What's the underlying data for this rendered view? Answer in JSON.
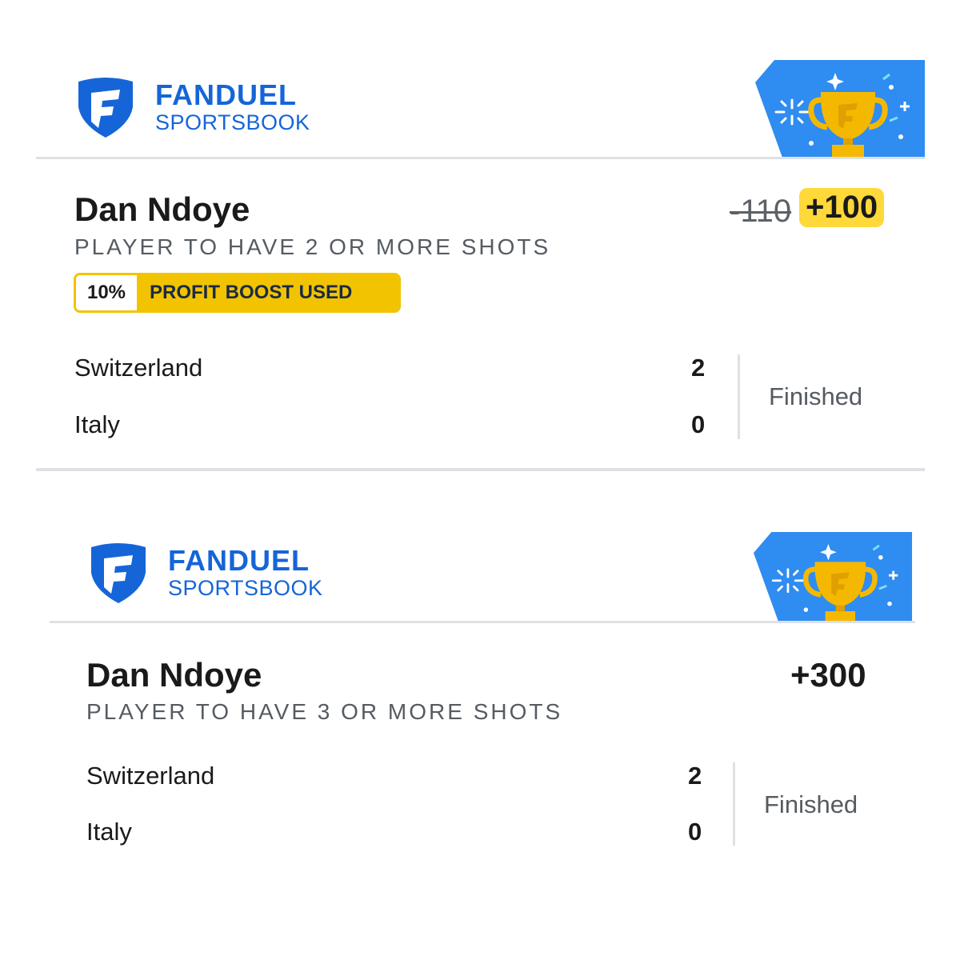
{
  "brand": {
    "line1": "FANDUEL",
    "line2": "SPORTSBOOK",
    "primary_color": "#1565d8",
    "badge_icon": "trophy-icon"
  },
  "bets": [
    {
      "player": "Dan Ndoye",
      "market": "PLAYER TO HAVE 2 OR MORE SHOTS",
      "odds_original": "-110",
      "odds_boosted": "+100",
      "boost_percent": "10%",
      "boost_label": "PROFIT BOOST USED",
      "teams": [
        {
          "name": "Switzerland",
          "score": "2"
        },
        {
          "name": "Italy",
          "score": "0"
        }
      ],
      "status": "Finished"
    },
    {
      "player": "Dan Ndoye",
      "market": "PLAYER TO HAVE 3 OR MORE SHOTS",
      "odds": "+300",
      "teams": [
        {
          "name": "Switzerland",
          "score": "2"
        },
        {
          "name": "Italy",
          "score": "0"
        }
      ],
      "status": "Finished"
    }
  ],
  "colors": {
    "boost_yellow": "#f2c300",
    "odds_highlight": "#ffd83a",
    "badge_blue": "#2f8cf0"
  }
}
